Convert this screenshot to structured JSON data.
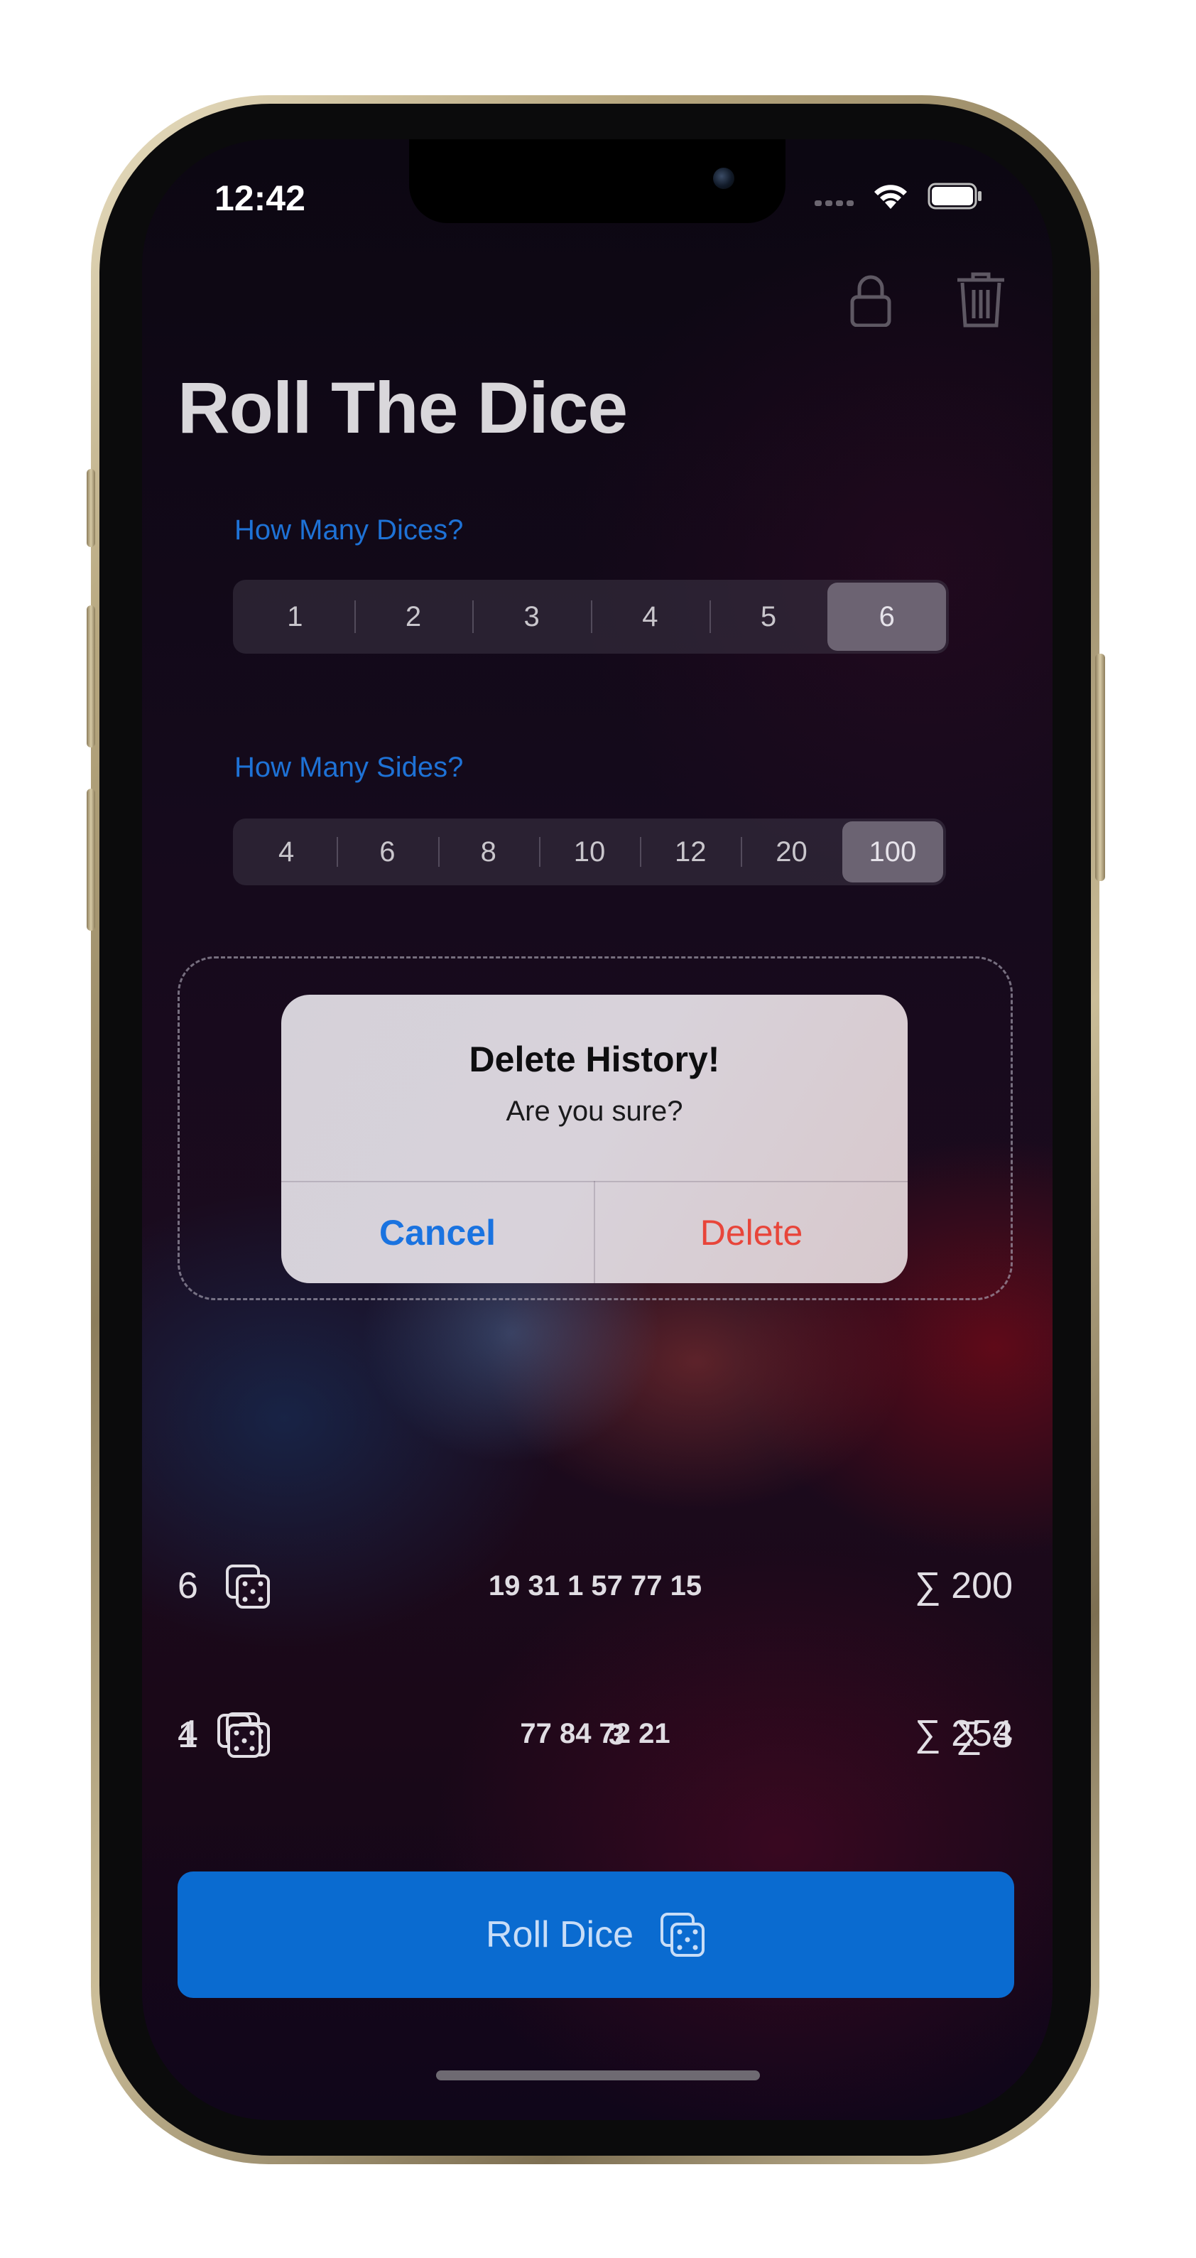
{
  "status_bar": {
    "time": "12:42"
  },
  "header": {
    "title": "Roll The Dice"
  },
  "dice_picker": {
    "label": "How Many Dices?",
    "options": [
      "1",
      "2",
      "3",
      "4",
      "5",
      "6"
    ],
    "selected": "6"
  },
  "sides_picker": {
    "label": "How Many Sides?",
    "options": [
      "4",
      "6",
      "8",
      "10",
      "12",
      "20",
      "100"
    ],
    "selected": "100"
  },
  "alert": {
    "title": "Delete History!",
    "message": "Are you sure?",
    "cancel_label": "Cancel",
    "delete_label": "Delete"
  },
  "history": [
    {
      "count": "6",
      "values": "19 31 1 57 77 15",
      "sum": "∑  200"
    },
    {
      "count": "4",
      "values": "77 84 72 21",
      "sum": "∑  254"
    },
    {
      "count": "1",
      "values": "3",
      "sum": "∑  3"
    }
  ],
  "roll_button": {
    "label": "Roll Dice"
  },
  "colors": {
    "accent": "#0a6bd0",
    "section_label": "#1e72d6",
    "destructive": "#e8453a"
  },
  "icons": [
    "lock-icon",
    "trash-icon",
    "dice-icon",
    "wifi-icon",
    "battery-icon"
  ]
}
